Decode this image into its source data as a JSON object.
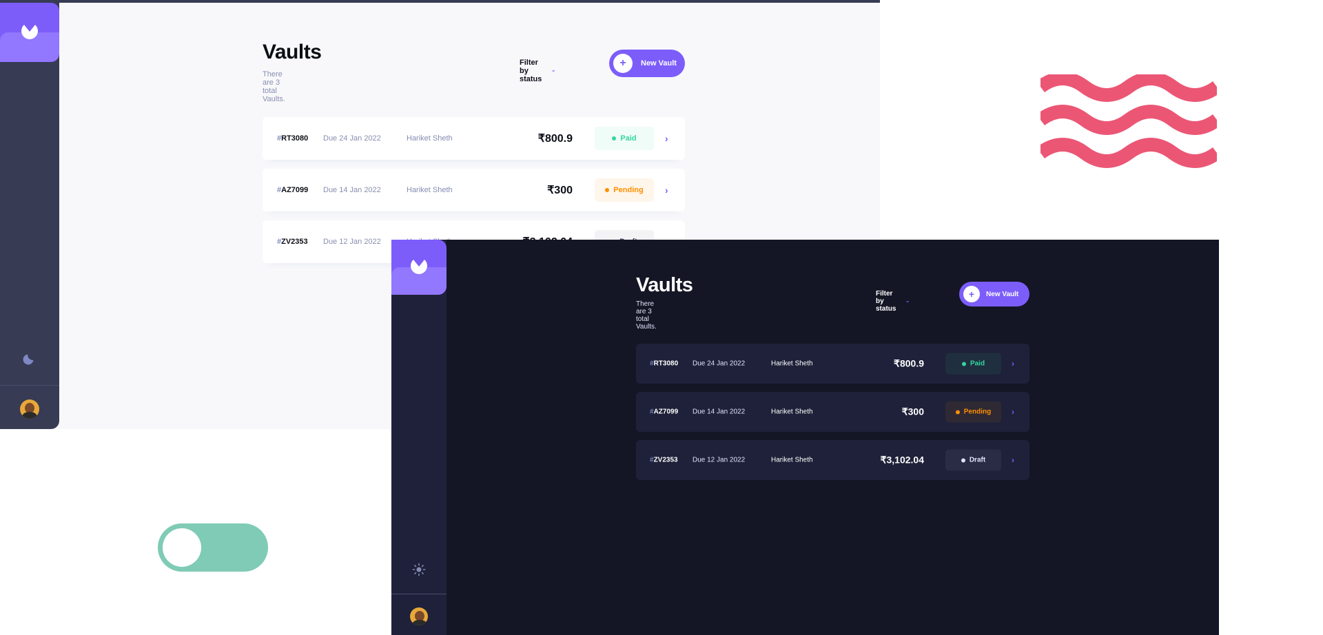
{
  "app": {
    "title": "Vaults",
    "subtitle": "There are 3 total Vaults.",
    "filter_label": "Filter by status",
    "new_button_label": "New Vault"
  },
  "colors": {
    "accent": "#7c5dfa",
    "accent_light": "#9277ff",
    "paid": "#33d69f",
    "pending": "#ff8f00",
    "draft_light": "#373b53",
    "draft_dark": "#dfe3fa",
    "toggle": "#7fcbb5",
    "waves": "#ec5675"
  },
  "icons": {
    "logo": "logo-icon",
    "light_theme_toggle": "moon-icon",
    "dark_theme_toggle": "sun-icon",
    "plus": "plus-icon",
    "filter_chevron": "chevron-down-icon",
    "row_chevron": "chevron-right-icon"
  },
  "vaults": [
    {
      "id_prefix": "#",
      "id": "RT3080",
      "due": "Due 24 Jan 2022",
      "name": "Hariket Sheth",
      "amount": "₹800.9",
      "status": "Paid"
    },
    {
      "id_prefix": "#",
      "id": "AZ7099",
      "due": "Due 14 Jan 2022",
      "name": "Hariket Sheth",
      "amount": "₹300",
      "status": "Pending"
    },
    {
      "id_prefix": "#",
      "id": "ZV2353",
      "due": "Due 12 Jan 2022",
      "name": "Hariket Sheth",
      "amount": "₹3,102.04",
      "status": "Draft"
    }
  ],
  "toggle": {
    "state": "off"
  }
}
